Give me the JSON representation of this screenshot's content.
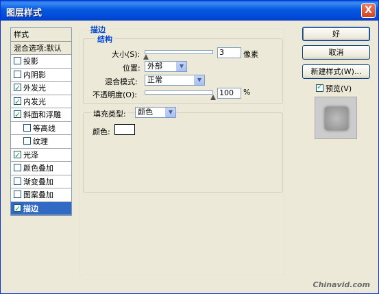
{
  "window": {
    "title": "图层样式",
    "close_label": "X"
  },
  "style_list": {
    "header": "样式",
    "blend_options": "混合选项:默认",
    "items": [
      {
        "label": "投影",
        "checked": false,
        "indent": false,
        "selected": false
      },
      {
        "label": "内阴影",
        "checked": false,
        "indent": false,
        "selected": false
      },
      {
        "label": "外发光",
        "checked": true,
        "indent": false,
        "selected": false
      },
      {
        "label": "内发光",
        "checked": true,
        "indent": false,
        "selected": false
      },
      {
        "label": "斜面和浮雕",
        "checked": true,
        "indent": false,
        "selected": false
      },
      {
        "label": "等高线",
        "checked": false,
        "indent": true,
        "selected": false
      },
      {
        "label": "纹理",
        "checked": false,
        "indent": true,
        "selected": false
      },
      {
        "label": "光泽",
        "checked": true,
        "indent": false,
        "selected": false
      },
      {
        "label": "颜色叠加",
        "checked": false,
        "indent": false,
        "selected": false
      },
      {
        "label": "渐变叠加",
        "checked": false,
        "indent": false,
        "selected": false
      },
      {
        "label": "图案叠加",
        "checked": false,
        "indent": false,
        "selected": false
      },
      {
        "label": "描边",
        "checked": true,
        "indent": false,
        "selected": true
      }
    ]
  },
  "stroke": {
    "section_title": "描边",
    "structure_title": "结构",
    "size_label": "大小(S):",
    "size_value": "3",
    "size_unit": "像素",
    "position_label": "位置:",
    "position_value": "外部",
    "blend_mode_label": "混合模式:",
    "blend_mode_value": "正常",
    "opacity_label": "不透明度(O):",
    "opacity_value": "100",
    "opacity_unit": "%",
    "fill_type_label": "填充类型:",
    "fill_type_value": "颜色",
    "color_label": "颜色:",
    "color_value": "#ffffff"
  },
  "buttons": {
    "ok": "好",
    "cancel": "取消",
    "new_style": "新建样式(W)...",
    "preview_label": "预览(V)",
    "preview_checked": true
  },
  "watermark": "Chinavid.com"
}
